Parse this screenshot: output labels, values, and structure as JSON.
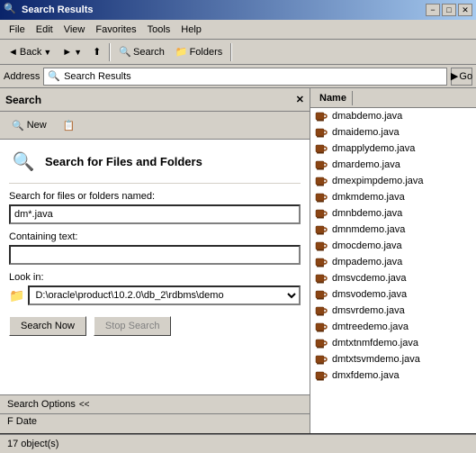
{
  "window": {
    "title": "Search Results",
    "icon": "🔍"
  },
  "titleButtons": {
    "minimize": "−",
    "maximize": "□",
    "close": "✕"
  },
  "menu": {
    "items": [
      "File",
      "Edit",
      "View",
      "Favorites",
      "Tools",
      "Help"
    ]
  },
  "toolbar": {
    "back": "Back",
    "forward": "Forward",
    "up": "Up",
    "search": "Search",
    "folders": "Folders"
  },
  "address": {
    "label": "Address",
    "value": "Search Results",
    "go": "Go"
  },
  "searchPanel": {
    "title": "Search",
    "closeLabel": "✕",
    "newLabel": "New",
    "heading": "Search for Files and Folders",
    "fileLabel": "Search for files or folders named:",
    "fileValue": "dm*.java",
    "containingLabel": "Containing text:",
    "containingValue": "",
    "lookInLabel": "Look in:",
    "lookInValue": "D:\\oracle\\product\\10.2.0\\db_2\\rdbms\\demo",
    "searchNow": "Search Now",
    "stopSearch": "Stop Search",
    "searchOptions": "Search Options",
    "chevron": "<<",
    "extraOption": "F Date"
  },
  "results": {
    "columnName": "Name",
    "items": [
      "dmabdemo.java",
      "dmaidemo.java",
      "dmapplydemo.java",
      "dmardemo.java",
      "dmexpimpdemo.java",
      "dmkmdemo.java",
      "dmnbdemo.java",
      "dmnmdemo.java",
      "dmocdemo.java",
      "dmpademo.java",
      "dmsvcdemo.java",
      "dmsvodemo.java",
      "dmsvrdemo.java",
      "dmtreedemo.java",
      "dmtxtnmfdemo.java",
      "dmtxtsvmdemo.java",
      "dmxfdemo.java"
    ]
  },
  "statusBar": {
    "text": "17 object(s)"
  }
}
